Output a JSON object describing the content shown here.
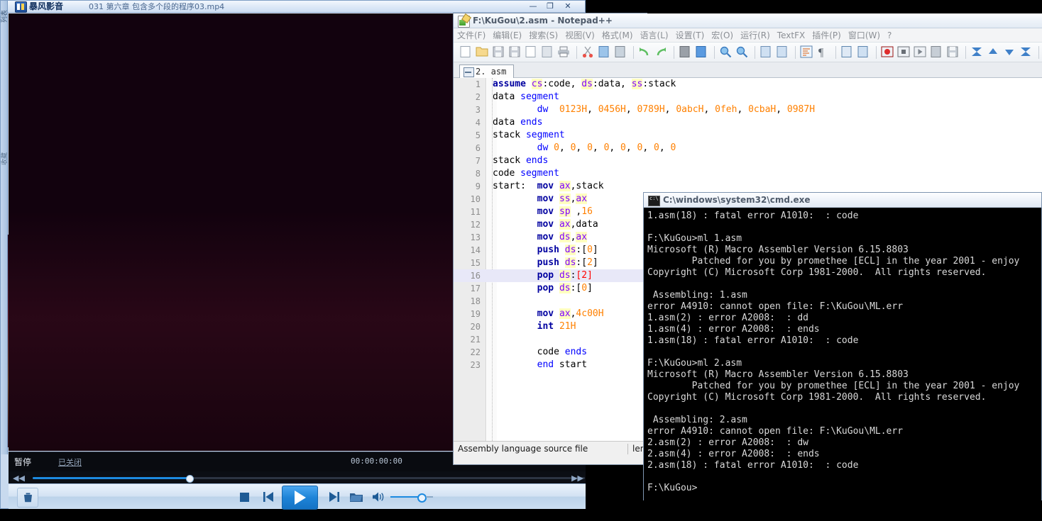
{
  "player": {
    "brand": "暴风影音",
    "filename": "031 第六章 包含多个段的程序03.mp4",
    "window_buttons": {
      "minimize": "—",
      "maximize": "❐",
      "close": "✕"
    },
    "side_tab_top": "列表",
    "side_tab_mid": "收藏",
    "status_state": "暂停",
    "status_link": "已关闭",
    "time_display": "00:00:00:00",
    "seek_rewind": "◀◀",
    "seek_forward": "▶▶",
    "controls": {
      "trash": "🗑",
      "stop": "■",
      "prev": "|◀",
      "play": "▶",
      "next": "▶|",
      "folder": "📂",
      "volume": "🔊"
    }
  },
  "notepad": {
    "title": "F:\\KuGou\\2.asm - Notepad++",
    "menu": [
      "文件(F)",
      "编辑(E)",
      "搜索(S)",
      "视图(V)",
      "格式(M)",
      "语言(L)",
      "设置(T)",
      "宏(O)",
      "运行(R)",
      "TextFX",
      "插件(P)",
      "窗口(W)",
      "?"
    ],
    "toolbar_icons": [
      "new-file-icon",
      "open-file-icon",
      "save-icon",
      "save-all-icon",
      "close-file-icon",
      "close-all-icon",
      "print-icon",
      "sep",
      "cut-icon",
      "copy-icon",
      "paste-icon",
      "sep",
      "undo-icon",
      "redo-icon",
      "sep",
      "find-icon",
      "replace-icon",
      "sep",
      "zoom-in-icon",
      "zoom-out-icon",
      "sep",
      "sync-scroll-v-icon",
      "sync-scroll-h-icon",
      "sep",
      "word-wrap-icon",
      "show-all-chars-icon",
      "sep",
      "indent-guide-icon",
      "user-language-icon",
      "sep",
      "record-macro-icon",
      "stop-macro-icon",
      "play-macro-icon",
      "run-macro-multiple-icon",
      "save-macro-icon",
      "sep",
      "collapse-all-icon",
      "collapse-level-icon",
      "expand-level-icon",
      "expand-all-icon",
      "sep",
      "show-summary-icon",
      "spell-check-icon"
    ],
    "tab": {
      "label": "2. asm",
      "icon": "saved-file-icon"
    },
    "status_type": "Assembly language source file",
    "status_length": "lengt",
    "code": [
      {
        "n": 1,
        "current": false,
        "tokens": [
          {
            "t": "assume ",
            "c": "kw2"
          },
          {
            "t": "cs",
            "c": "reg"
          },
          {
            "t": ":code, ",
            "c": "plain"
          },
          {
            "t": "ds",
            "c": "reg"
          },
          {
            "t": ":data, ",
            "c": "plain"
          },
          {
            "t": "ss",
            "c": "reg"
          },
          {
            "t": ":stack",
            "c": "plain"
          }
        ]
      },
      {
        "n": 2,
        "current": false,
        "tokens": [
          {
            "t": "data ",
            "c": "plain"
          },
          {
            "t": "segment",
            "c": "kw"
          }
        ]
      },
      {
        "n": 3,
        "current": false,
        "tokens": [
          {
            "t": "        ",
            "c": "plain"
          },
          {
            "t": "dw",
            "c": "kw"
          },
          {
            "t": "  ",
            "c": "plain"
          },
          {
            "t": "0123H",
            "c": "num"
          },
          {
            "t": ", ",
            "c": "plain"
          },
          {
            "t": "0456H",
            "c": "num"
          },
          {
            "t": ", ",
            "c": "plain"
          },
          {
            "t": "0789H",
            "c": "num"
          },
          {
            "t": ", ",
            "c": "plain"
          },
          {
            "t": "0abcH",
            "c": "num"
          },
          {
            "t": ", ",
            "c": "plain"
          },
          {
            "t": "0feh",
            "c": "num"
          },
          {
            "t": ", ",
            "c": "plain"
          },
          {
            "t": "0cbaH",
            "c": "num"
          },
          {
            "t": ", ",
            "c": "plain"
          },
          {
            "t": "0987H",
            "c": "num"
          }
        ]
      },
      {
        "n": 4,
        "current": false,
        "tokens": [
          {
            "t": "data ",
            "c": "plain"
          },
          {
            "t": "ends",
            "c": "kw"
          }
        ]
      },
      {
        "n": 5,
        "current": false,
        "tokens": [
          {
            "t": "stack ",
            "c": "plain"
          },
          {
            "t": "segment",
            "c": "kw"
          }
        ]
      },
      {
        "n": 6,
        "current": false,
        "tokens": [
          {
            "t": "        ",
            "c": "plain"
          },
          {
            "t": "dw",
            "c": "kw"
          },
          {
            "t": " ",
            "c": "plain"
          },
          {
            "t": "0",
            "c": "num"
          },
          {
            "t": ", ",
            "c": "plain"
          },
          {
            "t": "0",
            "c": "num"
          },
          {
            "t": ", ",
            "c": "plain"
          },
          {
            "t": "0",
            "c": "num"
          },
          {
            "t": ", ",
            "c": "plain"
          },
          {
            "t": "0",
            "c": "num"
          },
          {
            "t": ", ",
            "c": "plain"
          },
          {
            "t": "0",
            "c": "num"
          },
          {
            "t": ", ",
            "c": "plain"
          },
          {
            "t": "0",
            "c": "num"
          },
          {
            "t": ", ",
            "c": "plain"
          },
          {
            "t": "0",
            "c": "num"
          },
          {
            "t": ", ",
            "c": "plain"
          },
          {
            "t": "0",
            "c": "num"
          }
        ]
      },
      {
        "n": 7,
        "current": false,
        "tokens": [
          {
            "t": "stack ",
            "c": "plain"
          },
          {
            "t": "ends",
            "c": "kw"
          }
        ]
      },
      {
        "n": 8,
        "current": false,
        "tokens": [
          {
            "t": "code ",
            "c": "plain"
          },
          {
            "t": "segment",
            "c": "kw"
          }
        ]
      },
      {
        "n": 9,
        "current": false,
        "tokens": [
          {
            "t": "start:  ",
            "c": "plain"
          },
          {
            "t": "mov",
            "c": "kw2"
          },
          {
            "t": " ",
            "c": "plain"
          },
          {
            "t": "ax",
            "c": "reg"
          },
          {
            "t": ",stack",
            "c": "plain"
          }
        ]
      },
      {
        "n": 10,
        "current": false,
        "tokens": [
          {
            "t": "        ",
            "c": "plain"
          },
          {
            "t": "mov",
            "c": "kw2"
          },
          {
            "t": " ",
            "c": "plain"
          },
          {
            "t": "ss",
            "c": "reg"
          },
          {
            "t": ",",
            "c": "plain"
          },
          {
            "t": "ax",
            "c": "reg"
          }
        ]
      },
      {
        "n": 11,
        "current": false,
        "tokens": [
          {
            "t": "        ",
            "c": "plain"
          },
          {
            "t": "mov",
            "c": "kw2"
          },
          {
            "t": " ",
            "c": "plain"
          },
          {
            "t": "sp",
            "c": "reg"
          },
          {
            "t": " ,",
            "c": "plain"
          },
          {
            "t": "16",
            "c": "num"
          }
        ]
      },
      {
        "n": 12,
        "current": false,
        "tokens": [
          {
            "t": "        ",
            "c": "plain"
          },
          {
            "t": "mov",
            "c": "kw2"
          },
          {
            "t": " ",
            "c": "plain"
          },
          {
            "t": "ax",
            "c": "reg"
          },
          {
            "t": ",data",
            "c": "plain"
          }
        ]
      },
      {
        "n": 13,
        "current": false,
        "tokens": [
          {
            "t": "        ",
            "c": "plain"
          },
          {
            "t": "mov",
            "c": "kw2"
          },
          {
            "t": " ",
            "c": "plain"
          },
          {
            "t": "ds",
            "c": "reg"
          },
          {
            "t": ",",
            "c": "plain"
          },
          {
            "t": "ax",
            "c": "reg"
          }
        ]
      },
      {
        "n": 14,
        "current": false,
        "tokens": [
          {
            "t": "        ",
            "c": "plain"
          },
          {
            "t": "push",
            "c": "kw2"
          },
          {
            "t": " ",
            "c": "plain"
          },
          {
            "t": "ds",
            "c": "reg"
          },
          {
            "t": ":[",
            "c": "plain"
          },
          {
            "t": "0",
            "c": "num"
          },
          {
            "t": "]",
            "c": "plain"
          }
        ]
      },
      {
        "n": 15,
        "current": false,
        "tokens": [
          {
            "t": "        ",
            "c": "plain"
          },
          {
            "t": "push",
            "c": "kw2"
          },
          {
            "t": " ",
            "c": "plain"
          },
          {
            "t": "ds",
            "c": "reg"
          },
          {
            "t": ":[",
            "c": "plain"
          },
          {
            "t": "2",
            "c": "num"
          },
          {
            "t": "]",
            "c": "plain"
          }
        ]
      },
      {
        "n": 16,
        "current": true,
        "tokens": [
          {
            "t": "        ",
            "c": "plain"
          },
          {
            "t": "pop",
            "c": "kw2"
          },
          {
            "t": " ",
            "c": "plain"
          },
          {
            "t": "ds",
            "c": "reg"
          },
          {
            "t": ":",
            "c": "plain"
          },
          {
            "t": "[",
            "c": "numred"
          },
          {
            "t": "2",
            "c": "numred"
          },
          {
            "t": "]",
            "c": "numred"
          }
        ]
      },
      {
        "n": 17,
        "current": false,
        "tokens": [
          {
            "t": "        ",
            "c": "plain"
          },
          {
            "t": "pop",
            "c": "kw2"
          },
          {
            "t": " ",
            "c": "plain"
          },
          {
            "t": "ds",
            "c": "reg"
          },
          {
            "t": ":[",
            "c": "plain"
          },
          {
            "t": "0",
            "c": "num"
          },
          {
            "t": "]",
            "c": "plain"
          }
        ]
      },
      {
        "n": 18,
        "current": false,
        "tokens": []
      },
      {
        "n": 19,
        "current": false,
        "tokens": [
          {
            "t": "        ",
            "c": "plain"
          },
          {
            "t": "mov",
            "c": "kw2"
          },
          {
            "t": " ",
            "c": "plain"
          },
          {
            "t": "ax",
            "c": "reg"
          },
          {
            "t": ",",
            "c": "plain"
          },
          {
            "t": "4c00H",
            "c": "num"
          }
        ]
      },
      {
        "n": 20,
        "current": false,
        "tokens": [
          {
            "t": "        ",
            "c": "plain"
          },
          {
            "t": "int",
            "c": "kw2"
          },
          {
            "t": " ",
            "c": "plain"
          },
          {
            "t": "21H",
            "c": "num"
          }
        ]
      },
      {
        "n": 21,
        "current": false,
        "tokens": []
      },
      {
        "n": 22,
        "current": false,
        "tokens": [
          {
            "t": "        ",
            "c": "plain"
          },
          {
            "t": "code ",
            "c": "plain"
          },
          {
            "t": "ends",
            "c": "kw"
          }
        ]
      },
      {
        "n": 23,
        "current": false,
        "tokens": [
          {
            "t": "        ",
            "c": "plain"
          },
          {
            "t": "end",
            "c": "kw"
          },
          {
            "t": " start",
            "c": "plain"
          }
        ]
      }
    ]
  },
  "cmd": {
    "title": "C:\\windows\\system32\\cmd.exe",
    "lines": [
      "1.asm(18) : fatal error A1010:  : code",
      "",
      "F:\\KuGou>ml 1.asm",
      "Microsoft (R) Macro Assembler Version 6.15.8803",
      "        Patched for you by promethee [ECL] in the year 2001 - enjoy",
      "Copyright (C) Microsoft Corp 1981-2000.  All rights reserved.",
      "",
      " Assembling: 1.asm",
      "error A4910: cannot open file: F:\\KuGou\\ML.err",
      "1.asm(2) : error A2008:  : dd",
      "1.asm(4) : error A2008:  : ends",
      "1.asm(18) : fatal error A1010:  : code",
      "",
      "F:\\KuGou>ml 2.asm",
      "Microsoft (R) Macro Assembler Version 6.15.8803",
      "        Patched for you by promethee [ECL] in the year 2001 - enjoy",
      "Copyright (C) Microsoft Corp 1981-2000.  All rights reserved.",
      "",
      " Assembling: 2.asm",
      "error A4910: cannot open file: F:\\KuGou\\ML.err",
      "2.asm(2) : error A2008:  : dw",
      "2.asm(4) : error A2008:  : ends",
      "2.asm(18) : fatal error A1010:  : code",
      "",
      "F:\\KuGou>"
    ]
  },
  "colors": {
    "accent_blue": "#1c8ae0",
    "keyword_blue": "#0000ff",
    "instruction_blue": "#0000a0",
    "number_orange": "#ff8000",
    "brace_red": "#ff0000",
    "register_highlight": "#ffffc0",
    "console_bg": "#000000",
    "console_fg": "#d9d9d9"
  }
}
